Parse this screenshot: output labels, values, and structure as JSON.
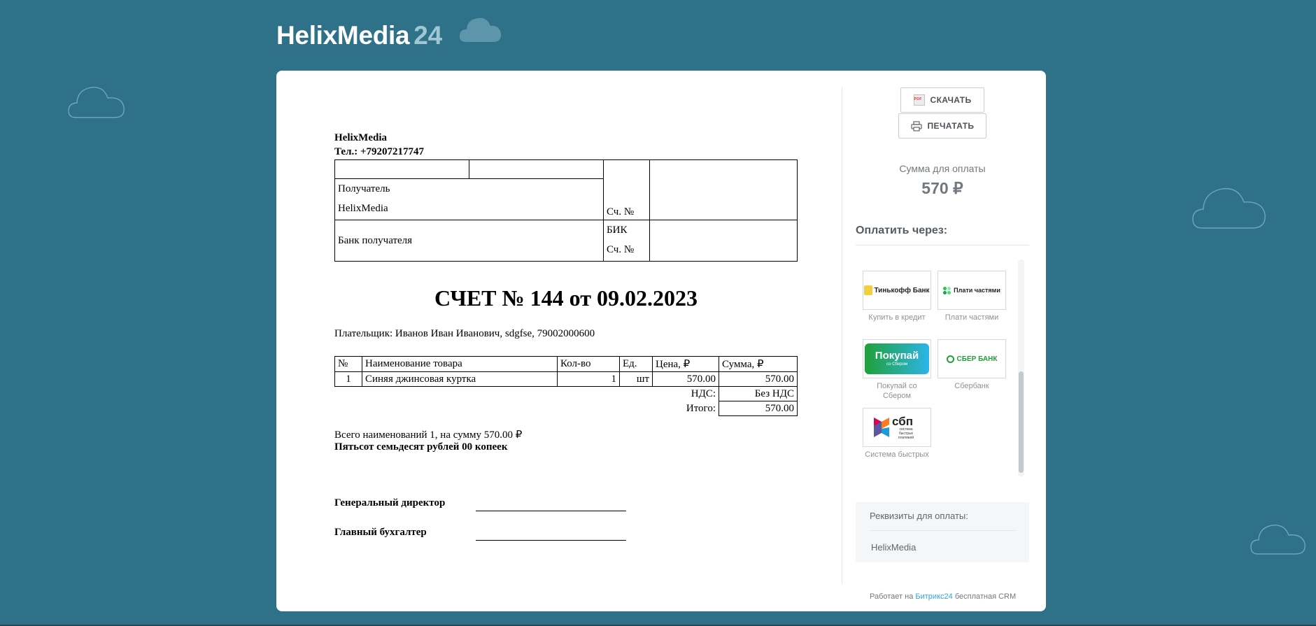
{
  "brand": {
    "name": "HelixMedia",
    "number": "24"
  },
  "invoice": {
    "seller_name": "HelixMedia",
    "seller_phone": "Тел.: +79207217747",
    "bank": {
      "recipient_label": "Получатель",
      "recipient_name": "HelixMedia",
      "account_label": "Сч. №",
      "recipient_bank_label": "Банк получателя",
      "bik_label": "БИК",
      "account_label_2": "Сч. №"
    },
    "title": "СЧЕТ № 144 от 09.02.2023",
    "payer": "Плательщик: Иванов Иван Иванович, sdgfse, 79002000600",
    "columns": [
      "№",
      "Наименование товара",
      "Кол-во",
      "Ед.",
      "Цена, ₽",
      "Сумма, ₽"
    ],
    "rows": [
      {
        "num": "1",
        "name": "Синяя джинсовая куртка",
        "qty": "1",
        "unit": "шт",
        "price": "570.00",
        "sum": "570.00"
      }
    ],
    "vat_label": "НДС:",
    "vat_value": "Без НДС",
    "total_label": "Итого:",
    "total_value": "570.00",
    "total_line": "Всего наименований 1, на сумму 570.00 ₽",
    "total_words": "Пятьсот семьдесят рублей 00 копеек",
    "director_label": "Генеральный директор",
    "accountant_label": "Главный бухгалтер"
  },
  "sidebar": {
    "download_label": "СКАЧАТЬ",
    "print_label": "ПЕЧАТАТЬ",
    "sum_label": "Сумма для оплаты",
    "sum_value": "570 ₽",
    "pay_via_label": "Оплатить через:",
    "methods": [
      {
        "logo_text": "Тинькофф Банк",
        "label": "Купить в кредит",
        "icon": "tinkoff-logo"
      },
      {
        "logo_text": "Плати частями",
        "label": "Плати частями",
        "icon": "plati-chastyami-logo"
      },
      {
        "logo_text": "Покупай",
        "logo_sub": "со Сбером",
        "label": "Покупай со Сбером",
        "icon": "pokupay-logo"
      },
      {
        "logo_text": "СБЕР БАНК",
        "label": "Сбербанк",
        "icon": "sberbank-logo"
      },
      {
        "logo_text": "сбп",
        "logo_sub": "система быстрых платежей",
        "label": "Система быстрых",
        "icon": "sbp-logo"
      }
    ],
    "requisites_title": "Реквизиты для оплаты:",
    "requisites_name": "HelixMedia"
  },
  "footer": {
    "prefix": "Работает на",
    "brand": "Битрикс24",
    "suffix": "бесплатная CRM"
  },
  "colors": {
    "background": "#2f7189",
    "card": "#ffffff",
    "accent": "#2fa7d9",
    "sber_green": "#21a038"
  }
}
